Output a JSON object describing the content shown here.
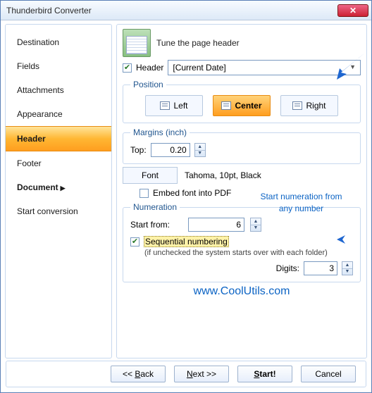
{
  "window": {
    "title": "Thunderbird Converter"
  },
  "sidebar": {
    "items": [
      {
        "label": "Destination"
      },
      {
        "label": "Fields"
      },
      {
        "label": "Attachments"
      },
      {
        "label": "Appearance"
      },
      {
        "label": "Header"
      },
      {
        "label": "Footer"
      },
      {
        "label": "Document"
      },
      {
        "label": "Start conversion"
      }
    ]
  },
  "main": {
    "subtitle": "Tune the page header",
    "header_checkbox_label": "Header",
    "header_value": "[Current Date]",
    "position": {
      "legend": "Position",
      "left": "Left",
      "center": "Center",
      "right": "Right"
    },
    "margins": {
      "legend": "Margins (inch)",
      "top_label": "Top:",
      "top_value": "0.20"
    },
    "font": {
      "button": "Font",
      "desc": "Tahoma, 10pt, Black",
      "embed": "Embed font into PDF"
    },
    "numeration": {
      "legend": "Numeration",
      "start_label": "Start from:",
      "start_value": "6",
      "sequential": "Sequential numbering",
      "note": "(if unchecked the system starts over with each folder)",
      "digits_label": "Digits:",
      "digits_value": "3"
    },
    "url": "www.CoolUtils.com"
  },
  "annotation": {
    "line1": "Start numeration from",
    "line2": "any number"
  },
  "buttons": {
    "back": "<< Back",
    "next": "Next >>",
    "start": "Start!",
    "cancel": "Cancel"
  }
}
